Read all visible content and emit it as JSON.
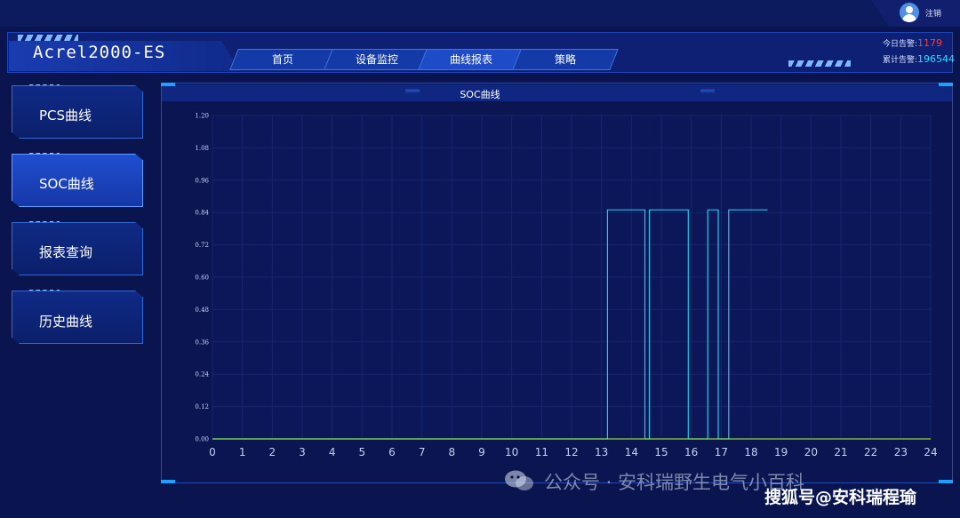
{
  "topbar": {
    "logout_label": "注销"
  },
  "header": {
    "app_title": "Acrel2000-ES",
    "nav": [
      "首页",
      "设备监控",
      "曲线报表",
      "策略"
    ],
    "alarms": {
      "today_label": "今日告警:",
      "today_value": "1179",
      "total_label": "累计告警:",
      "total_value": "196544"
    }
  },
  "sidebar": {
    "items": [
      {
        "label": "PCS曲线"
      },
      {
        "label": "SOC曲线"
      },
      {
        "label": "报表查询"
      },
      {
        "label": "历史曲线"
      }
    ],
    "active_index": 1
  },
  "panel": {
    "title": "SOC曲线"
  },
  "chart_data": {
    "type": "line",
    "title": "SOC曲线",
    "xlabel": "",
    "ylabel": "",
    "xlim": [
      0,
      24
    ],
    "ylim": [
      0,
      1.2
    ],
    "x_ticks": [
      "0",
      "1",
      "2",
      "3",
      "4",
      "5",
      "6",
      "7",
      "8",
      "9",
      "10",
      "11",
      "12",
      "13",
      "14",
      "15",
      "16",
      "17",
      "18",
      "19",
      "20",
      "21",
      "22",
      "23",
      "24"
    ],
    "y_ticks": [
      "0.00",
      "0.12",
      "0.24",
      "0.36",
      "0.48",
      "0.60",
      "0.72",
      "0.84",
      "0.96",
      "1.08",
      "1.20"
    ],
    "grid": true,
    "series": [
      {
        "color": "#1ec8e8",
        "x": [
          0,
          13.2,
          13.2,
          14.45,
          14.45,
          14.6,
          14.6,
          15.9,
          15.9,
          16.55,
          16.55,
          16.9,
          16.9,
          17.25,
          17.25,
          18.55
        ],
        "y": [
          0,
          0,
          0.85,
          0.85,
          0,
          0,
          0.85,
          0.85,
          0,
          0,
          0.85,
          0.85,
          0,
          0,
          0.85,
          0.85
        ]
      },
      {
        "color": "#8fd43a",
        "x": [
          0,
          24
        ],
        "y": [
          0,
          0
        ]
      }
    ]
  },
  "watermarks": {
    "text1": "公众号 · 安科瑞野生电气小百科",
    "text2": "搜狐号@安科瑞程瑜"
  }
}
